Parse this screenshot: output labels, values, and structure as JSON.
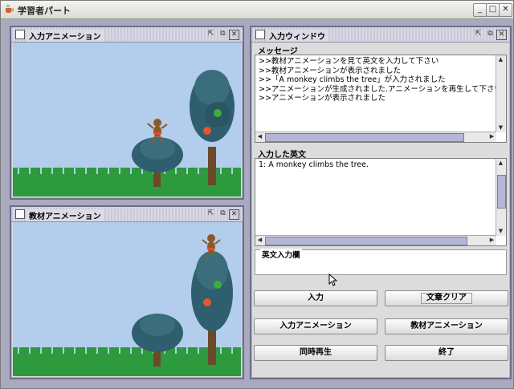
{
  "app": {
    "title": "学習者パート"
  },
  "panels": {
    "input_animation": {
      "title": "入力アニメーション"
    },
    "material_animation": {
      "title": "教材アニメーション"
    },
    "input_window": {
      "title": "入力ウィンドウ",
      "message_label": "メッセージ",
      "messages": [
        ">>教材アニメーションを見て英文を入力して下さい",
        ">>教材アニメーションが表示されました",
        ">>「A monkey climbs the tree」が入力されました",
        ">>アニメーションが生成されました.アニメーションを再生して下さい",
        ">>アニメーションが表示されました"
      ],
      "entered_label": "入力した英文",
      "entered": [
        "1: A monkey climbs the tree."
      ],
      "input_field_label": "英文入力欄",
      "input_value": ""
    }
  },
  "buttons": {
    "input": "入力",
    "clear": "文章クリア",
    "input_anim": "入力アニメーション",
    "material_anim": "教材アニメーション",
    "play_both": "同時再生",
    "finish": "終了"
  },
  "icons": {
    "window_minimize": "minimize-icon",
    "window_maximize": "maximize-icon",
    "window_close": "close-icon"
  }
}
